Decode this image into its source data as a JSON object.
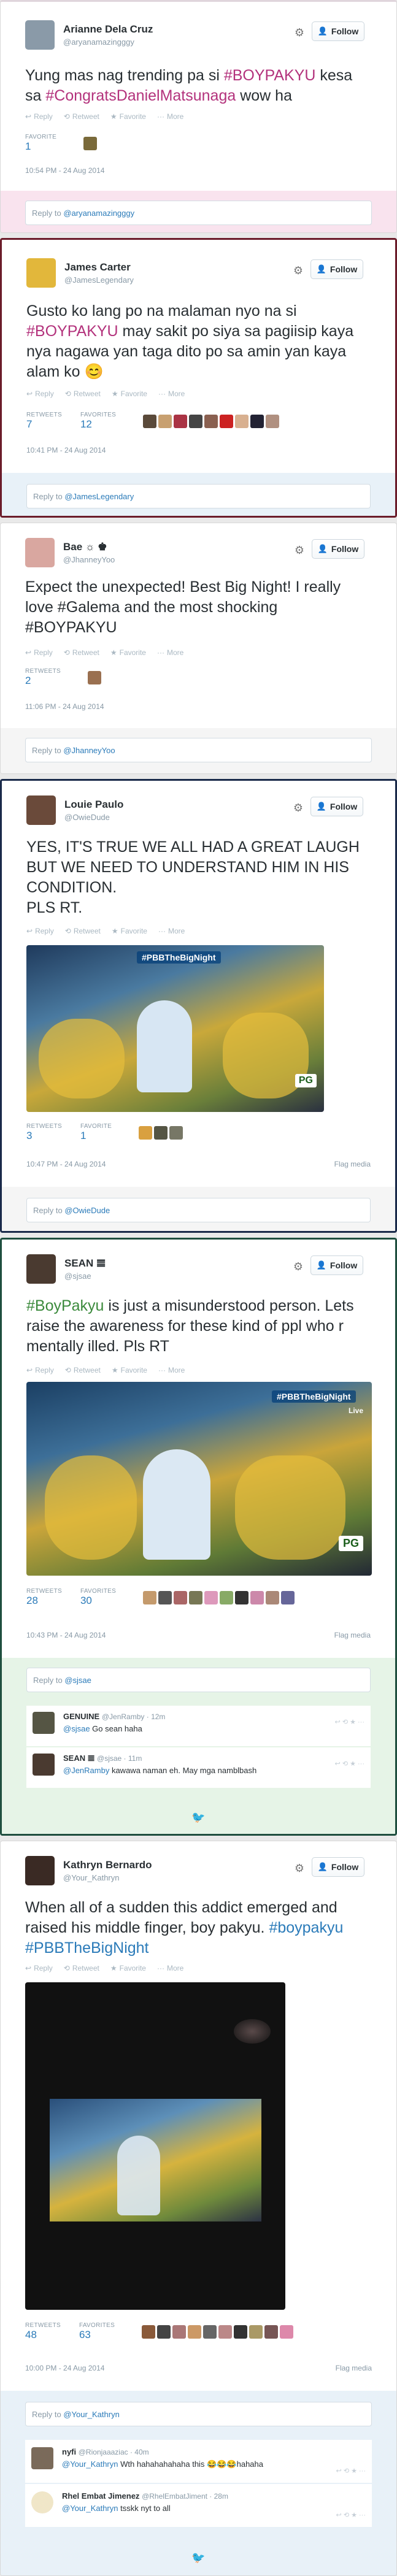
{
  "tweets": [
    {
      "name": "Arianne Dela Cruz",
      "handle": "@aryanamazingggy",
      "follow": "Follow",
      "text_parts": [
        "Yung mas nag trending pa si ",
        "#BOYPAKYU",
        " kesa sa ",
        "#CongratsDanielMatsunaga",
        " wow ha"
      ],
      "actions": {
        "reply": "Reply",
        "retweet": "Retweet",
        "favorite": "Favorite",
        "more": "More"
      },
      "fav_label": "FAVORITE",
      "fav_value": "1",
      "timestamp": "10:54 PM - 24 Aug 2014",
      "reply_prefix": "Reply to ",
      "reply_mention": "@aryanamazingggy"
    },
    {
      "name": "James Carter",
      "handle": "@JamesLegendary",
      "follow": "Follow",
      "text_parts": [
        "Gusto ko lang po na malaman nyo na si ",
        "#BOYPAKYU",
        " may sakit po siya sa pagiisip kaya nya nagawa yan taga dito po sa amin yan kaya alam ko 😊"
      ],
      "actions": {
        "reply": "Reply",
        "retweet": "Retweet",
        "favorite": "Favorite",
        "more": "More"
      },
      "rt_label": "RETWEETS",
      "rt_value": "7",
      "fav_label": "FAVORITES",
      "fav_value": "12",
      "timestamp": "10:41 PM - 24 Aug 2014",
      "reply_prefix": "Reply to ",
      "reply_mention": "@JamesLegendary"
    },
    {
      "name": "Bae ☼ ♚",
      "handle": "@JhanneyYoo",
      "follow": "Follow",
      "text_parts": [
        "Expect the unexpected! Best Big Night! I really love #Galema and the most shocking #BOYPAKYU"
      ],
      "actions": {
        "reply": "Reply",
        "retweet": "Retweet",
        "favorite": "Favorite",
        "more": "More"
      },
      "rt_label": "RETWEETS",
      "rt_value": "2",
      "timestamp": "11:06 PM - 24 Aug 2014",
      "reply_prefix": "Reply to ",
      "reply_mention": "@JhanneyYoo"
    },
    {
      "name": "Louie Paulo",
      "handle": "@OwieDude",
      "follow": "Follow",
      "text_parts": [
        "YES, IT'S TRUE WE ALL HAD A GREAT LAUGH BUT WE NEED TO UNDERSTAND HIM IN HIS CONDITION.",
        "PLS RT."
      ],
      "actions": {
        "reply": "Reply",
        "retweet": "Retweet",
        "favorite": "Favorite",
        "more": "More"
      },
      "photo_caption": "#PBBTheBigNight",
      "photo_badge": "PG",
      "rt_label": "RETWEETS",
      "rt_value": "3",
      "fav_label": "FAVORITE",
      "fav_value": "1",
      "timestamp": "10:47 PM - 24 Aug 2014",
      "flag": "Flag media",
      "reply_prefix": "Reply to ",
      "reply_mention": "@OwieDude"
    },
    {
      "name": "SEAN 𝌆",
      "handle": "@sjsae",
      "follow": "Follow",
      "text_parts": [
        "#BoyPakyu",
        " is just a misunderstood person. Lets raise the awareness for these kind of ppl who r mentally illed. Pls RT"
      ],
      "actions": {
        "reply": "Reply",
        "retweet": "Retweet",
        "favorite": "Favorite",
        "more": "More"
      },
      "photo_caption": "#PBBTheBigNight",
      "photo_badge": "PG",
      "photo_live": "Live",
      "rt_label": "RETWEETS",
      "rt_value": "28",
      "fav_label": "FAVORITES",
      "fav_value": "30",
      "timestamp": "10:43 PM - 24 Aug 2014",
      "flag": "Flag media",
      "reply_prefix": "Reply to ",
      "reply_mention": "@sjsae",
      "replies": [
        {
          "name": "GENUINE",
          "handle": "@JenRamby · 12m",
          "mention": "@sjsae",
          "text": " Go sean haha"
        },
        {
          "name": "SEAN 𝌆",
          "handle": "@sjsae · 11m",
          "mention": "@JenRamby",
          "text": " kawawa naman eh. May mga namblbash"
        }
      ]
    },
    {
      "name": "Kathryn Bernardo",
      "handle": "@Your_Kathryn",
      "follow": "Follow",
      "text_parts": [
        "When all of a sudden this addict emerged and raised his middle finger, boy pakyu. ",
        "#boypakyu #PBBTheBigNight"
      ],
      "actions": {
        "reply": "Reply",
        "retweet": "Retweet",
        "favorite": "Favorite",
        "more": "More"
      },
      "rt_label": "RETWEETS",
      "rt_value": "48",
      "fav_label": "FAVORITES",
      "fav_value": "63",
      "timestamp": "10:00 PM - 24 Aug 2014",
      "flag": "Flag media",
      "reply_prefix": "Reply to ",
      "reply_mention": "@Your_Kathryn",
      "replies": [
        {
          "name": "nyfi",
          "handle": "@Rionjaaaziac · 40m",
          "mention": "@Your_Kathryn",
          "text": " Wth hahahahahaha this 😂😂😂hahaha"
        },
        {
          "name": "Rhel Embat Jimenez",
          "handle": "@RhelEmbatJiment · 28m",
          "mention": "@Your_Kathryn",
          "text": " tsskk nyt to all"
        }
      ]
    }
  ],
  "colors": {
    "hashtag_pink": "#b3327c",
    "hashtag_blue": "#2b7bb9",
    "hashtag_green": "#3b8a3c",
    "link": "#2b7bb9"
  }
}
